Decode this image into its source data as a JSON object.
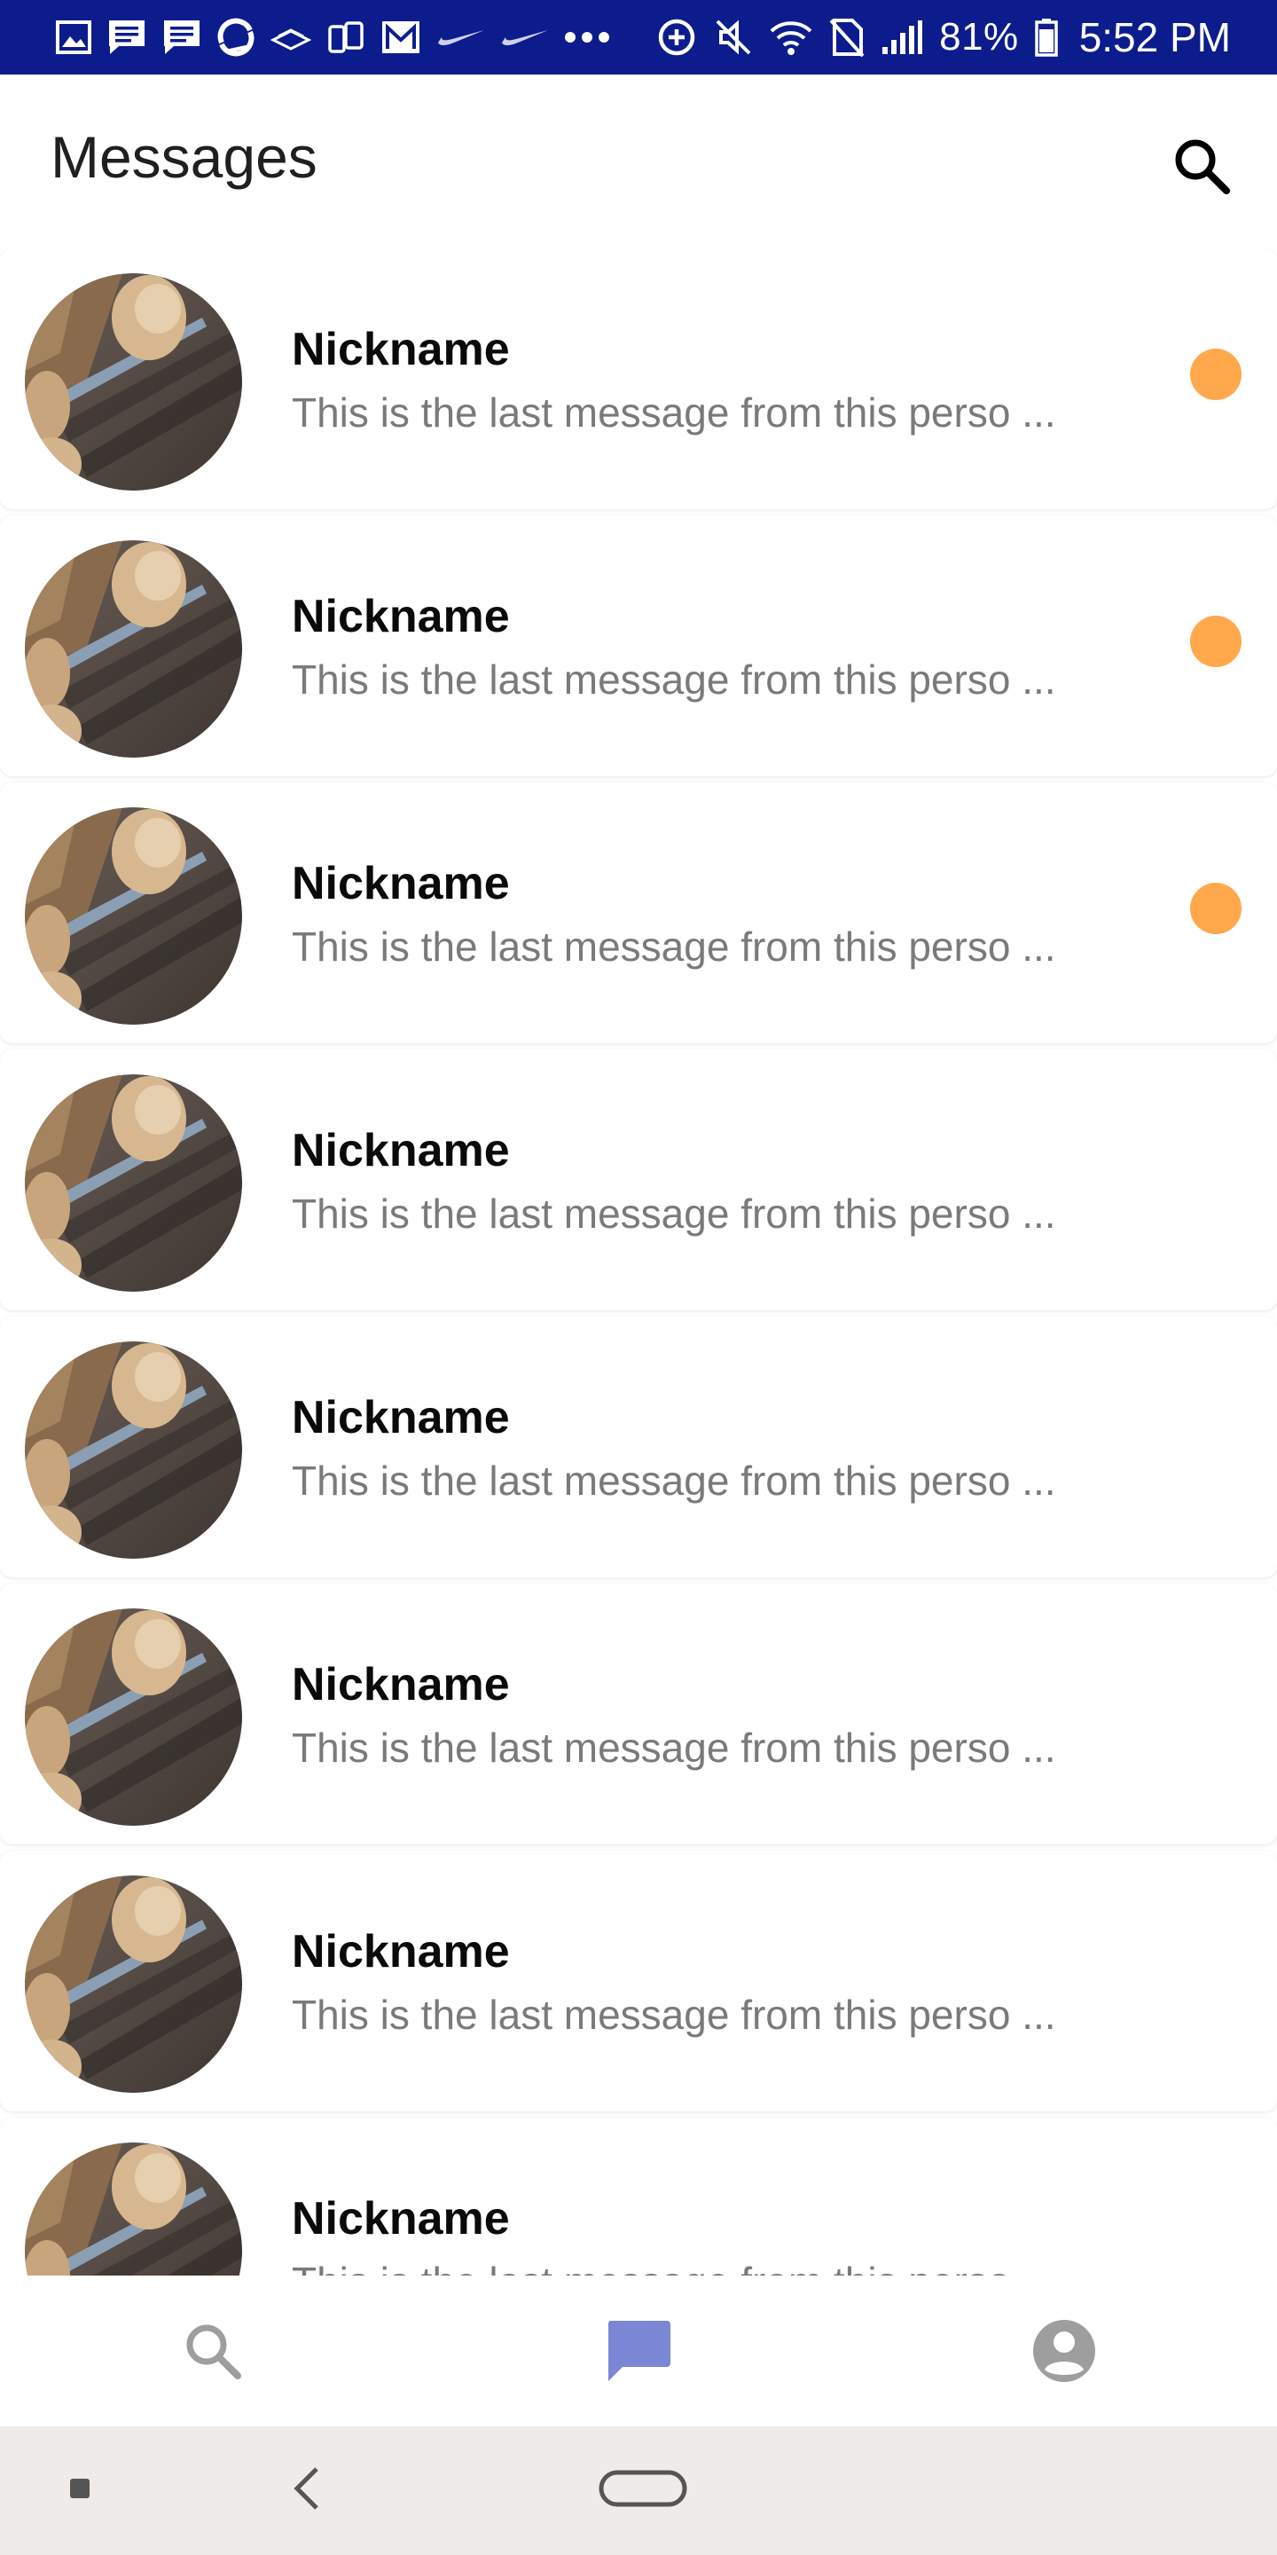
{
  "status_bar": {
    "battery": "81%",
    "time": "5:52 PM",
    "icons_left": [
      "gallery-icon",
      "message-icon",
      "message-icon",
      "sync-icon",
      "wifi-stack-icon",
      "stories-icon",
      "gmail-icon",
      "nike-icon",
      "nike-icon",
      "more-dots-icon"
    ],
    "icons_right": [
      "data-saver-icon",
      "mute-icon",
      "wifi-icon",
      "no-sim-icon",
      "signal-icon",
      "battery-icon"
    ]
  },
  "header": {
    "title": "Messages",
    "search_icon": "search-icon"
  },
  "conversations": [
    {
      "nickname": "Nickname",
      "last_message": "This is the last message from this perso ...",
      "unread": true
    },
    {
      "nickname": "Nickname",
      "last_message": "This is the last message from this perso ...",
      "unread": true
    },
    {
      "nickname": "Nickname",
      "last_message": "This is the last message from this perso ...",
      "unread": true
    },
    {
      "nickname": "Nickname",
      "last_message": "This is the last message from this perso ...",
      "unread": false
    },
    {
      "nickname": "Nickname",
      "last_message": "This is the last message from this perso ...",
      "unread": false
    },
    {
      "nickname": "Nickname",
      "last_message": "This is the last message from this perso ...",
      "unread": false
    },
    {
      "nickname": "Nickname",
      "last_message": "This is the last message from this perso ...",
      "unread": false
    },
    {
      "nickname": "Nickname",
      "last_message": "This is the last message from this perso ...",
      "unread": false
    }
  ],
  "bottom_nav": [
    {
      "icon": "search-icon",
      "active": false
    },
    {
      "icon": "chat-icon",
      "active": true
    },
    {
      "icon": "account-icon",
      "active": false
    }
  ],
  "system_nav": [
    "recents-icon",
    "back-icon",
    "home-icon"
  ],
  "colors": {
    "status_bar": "#0d1c8c",
    "unread_dot": "#ffa84c",
    "nav_active": "#7b86d4",
    "nav_inactive": "#9e9e9e",
    "system_nav": "#efebe8"
  }
}
